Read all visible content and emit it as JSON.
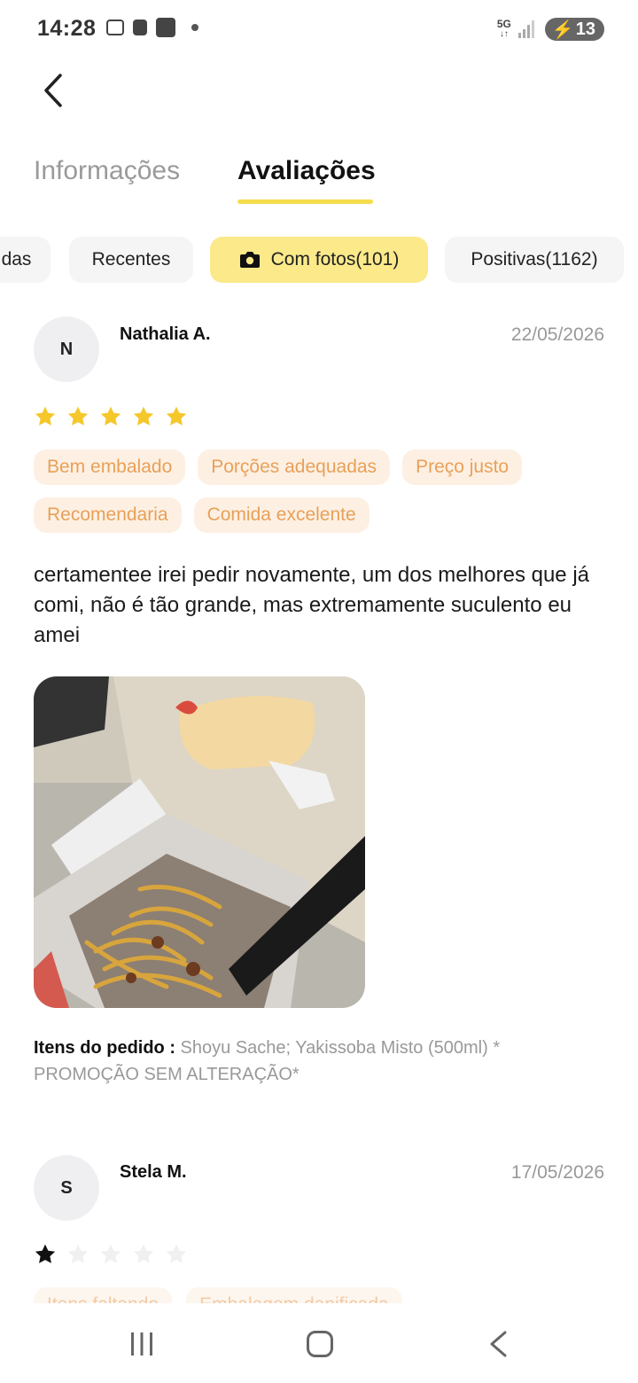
{
  "status_bar": {
    "time": "14:28",
    "network": "5G",
    "battery": "13"
  },
  "tabs": [
    {
      "label": "Informações",
      "active": false
    },
    {
      "label": "Avaliações",
      "active": true
    }
  ],
  "filters": [
    {
      "label": "das"
    },
    {
      "label": "Recentes"
    },
    {
      "label": "Com fotos(101)",
      "active": true,
      "icon": "camera-icon"
    },
    {
      "label": "Positivas(1162)"
    }
  ],
  "reviews": [
    {
      "initial": "N",
      "name": "Nathalia A.",
      "date": "22/05/2026",
      "rating": 5,
      "tags": [
        "Bem embalado",
        "Porções adequadas",
        "Preço justo",
        "Recomendaria",
        "Comida excelente"
      ],
      "text": "certamentee irei pedir novamente, um dos melhores que já comi, não é tão grande, mas extremamente suculento eu amei",
      "order_label": "Itens do pedido :",
      "order_items": " Shoyu Sache;  Yakissoba Misto (500ml) * PROMOÇÃO SEM ALTERAÇÃO*"
    },
    {
      "initial": "S",
      "name": "Stela M.",
      "date": "17/05/2026",
      "rating": 1,
      "tags": [
        "Itens faltando",
        "Embalagem danificada"
      ]
    }
  ],
  "colors": {
    "accent_yellow": "#f5dd4b",
    "chip_active": "#fbe98a",
    "tag_bg": "#fdf0e3",
    "tag_text": "#e8a058",
    "star": "#f5c72b"
  }
}
